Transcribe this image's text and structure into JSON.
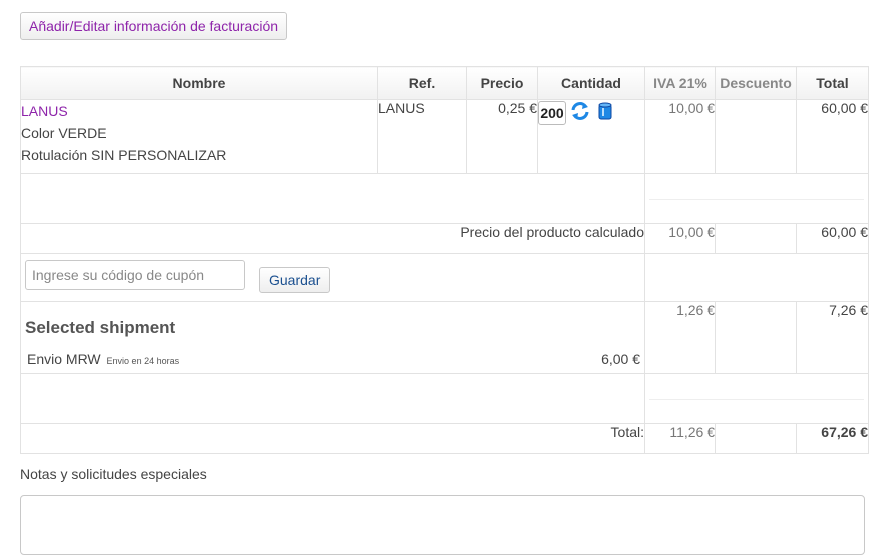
{
  "billing": {
    "button_label": "Añadir/Editar información de facturación"
  },
  "table": {
    "headers": {
      "name": "Nombre",
      "ref": "Ref.",
      "price": "Precio",
      "quantity": "Cantidad",
      "tax": "IVA 21%",
      "discount": "Descuento",
      "total": "Total"
    },
    "product": {
      "name": "LANUS",
      "attributes": [
        "Color VERDE",
        "Rotulación SIN PERSONALIZAR"
      ],
      "ref": "LANUS",
      "price": "0,25 €",
      "quantity": "200",
      "tax": "10,00 €",
      "discount": "",
      "total": "60,00 €"
    },
    "product_subtotal": {
      "label": "Precio del producto calculado",
      "tax": "10,00 €",
      "total": "60,00 €"
    },
    "coupon": {
      "placeholder": "Ingrese su código de cupón",
      "save_label": "Guardar"
    },
    "shipment": {
      "title": "Selected shipment",
      "method": "Envio MRW",
      "method_note": "Envio en 24 horas",
      "price": "6,00 €",
      "tax": "1,26 €",
      "total": "7,26 €"
    },
    "grand_total": {
      "label": "Total:",
      "tax": "11,26 €",
      "total": "67,26 €"
    }
  },
  "notes": {
    "label": "Notas y solicitudes especiales"
  },
  "icons": {
    "update": "refresh-icon",
    "delete": "trash-icon"
  },
  "colors": {
    "link": "#8e24aa",
    "save_button_text": "#1a4f8f",
    "icon_blue": "#1e88e5"
  }
}
